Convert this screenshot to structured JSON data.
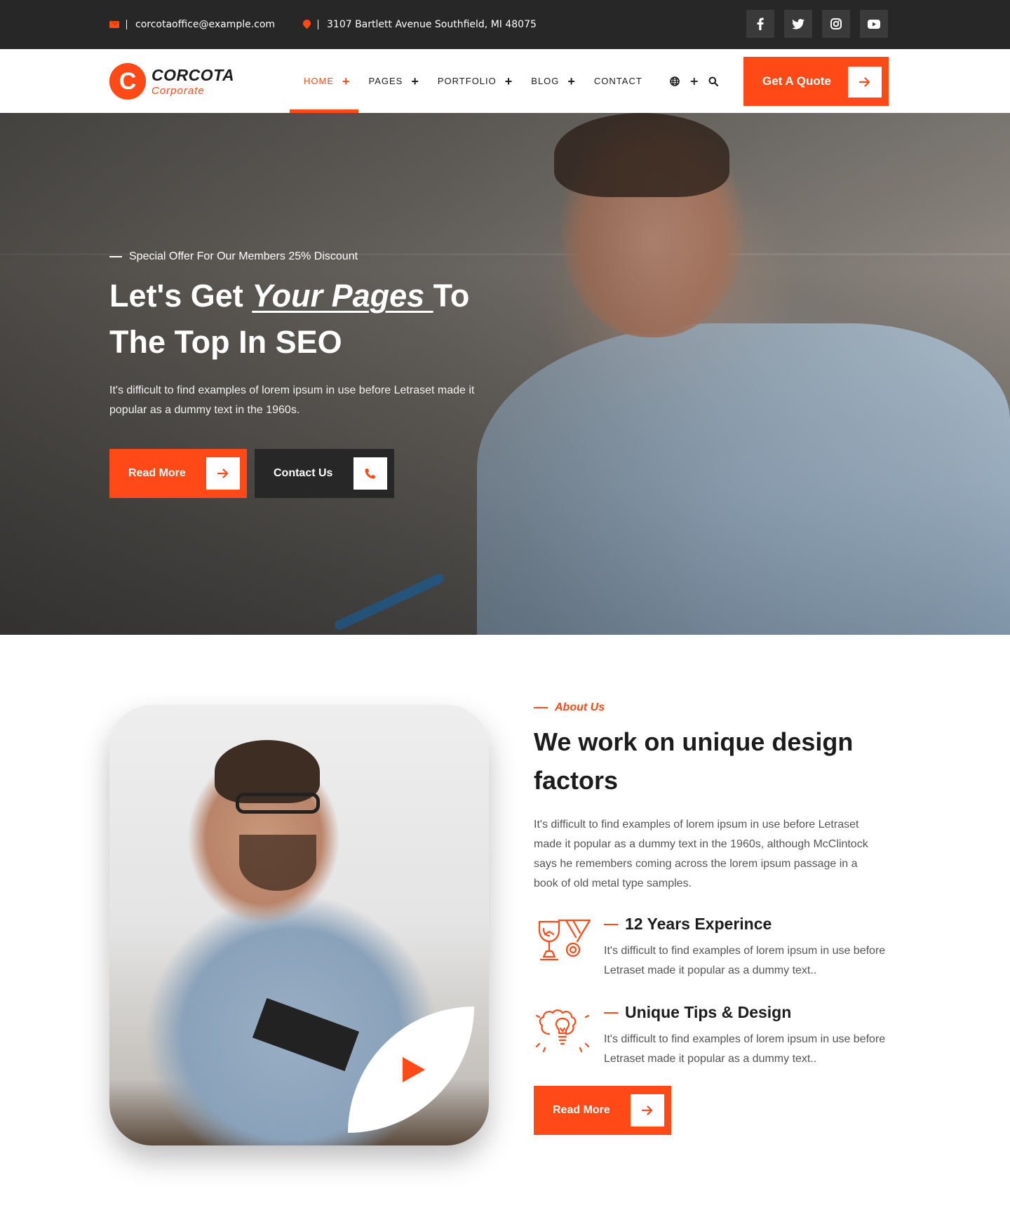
{
  "colors": {
    "accent": "#ff4a17",
    "dark": "#272727"
  },
  "topbar": {
    "email": "corcotaoffice@example.com",
    "address": "3107 Bartlett Avenue Southfield, MI 48075",
    "social": [
      "facebook-icon",
      "twitter-icon",
      "instagram-icon",
      "youtube-icon"
    ]
  },
  "header": {
    "logo": {
      "letter": "C",
      "name": "CORCOTA",
      "tagline": "Corporate"
    },
    "nav": [
      {
        "label": "HOME",
        "plus": "+"
      },
      {
        "label": "PAGES",
        "plus": "+"
      },
      {
        "label": "PORTFOLIO",
        "plus": "+"
      },
      {
        "label": "BLOG",
        "plus": "+"
      },
      {
        "label": "CONTACT",
        "plus": ""
      }
    ],
    "tools": {
      "plus": "+"
    },
    "quote_button": "Get A Quote"
  },
  "hero": {
    "kicker": "Special Offer For Our Members 25% Discount",
    "title_start": "Let's Get ",
    "title_em": "Your Pages ",
    "title_end": "To The Top In SEO",
    "description": "It's difficult to find examples of lorem ipsum in use before Letraset made it popular as a dummy text in the 1960s.",
    "read_more": "Read More",
    "contact_us": "Contact Us"
  },
  "about": {
    "kicker": "About Us",
    "heading": "We work on unique design factors",
    "description": "It's difficult to find examples of lorem ipsum in use before Letraset made it popular as a dummy text in the 1960s, although McClintock says he remembers coming across the lorem ipsum passage in a book of old metal type samples.",
    "features": [
      {
        "icon": "award-trophy-icon",
        "title": "12 Years Experince",
        "text": "It's difficult to find examples of lorem ipsum in use before Letraset made it popular as a dummy text.."
      },
      {
        "icon": "idea-bulb-icon",
        "title": "Unique Tips & Design",
        "text": "It's difficult to find examples of lorem ipsum in use before Letraset made it popular as a dummy text.."
      }
    ],
    "read_more": "Read More"
  }
}
